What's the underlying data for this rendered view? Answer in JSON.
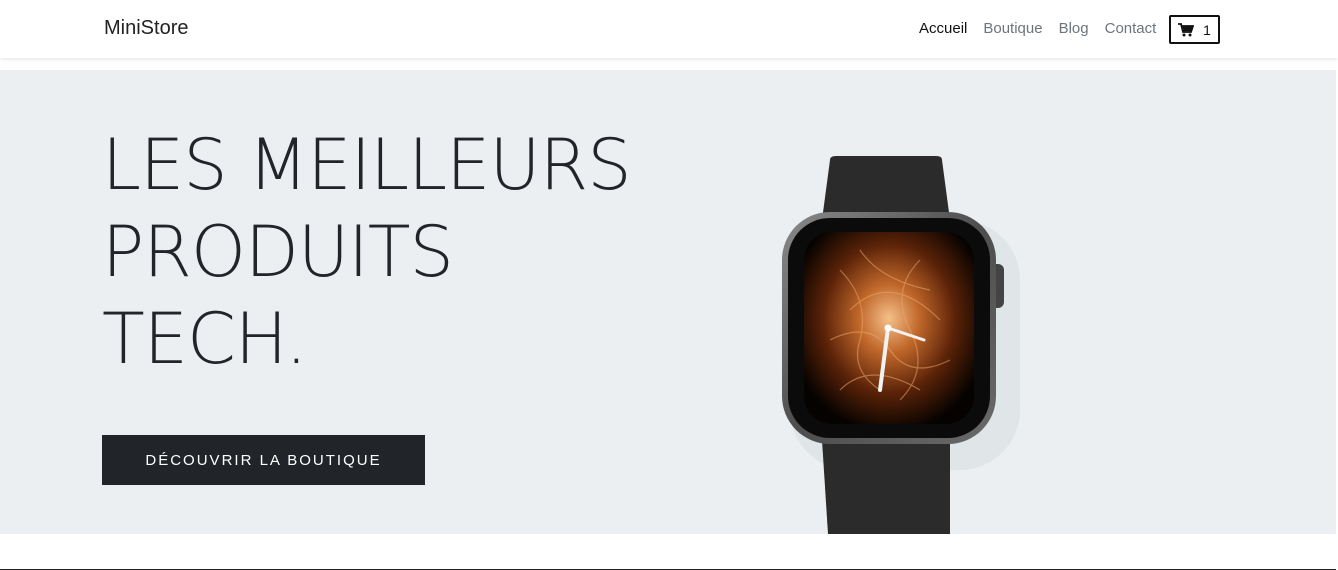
{
  "navbar": {
    "brand": "MiniStore",
    "links": [
      "Accueil",
      "Boutique",
      "Blog",
      "Contact"
    ],
    "cart_count": "1"
  },
  "hero": {
    "headline_lines": [
      "LES MEILLEURS",
      "PRODUITS",
      "TECH."
    ],
    "cta_label": "DÉCOUVRIR LA BOUTIQUE",
    "image": "smartwatch"
  },
  "icons": {
    "cart": "shopping-cart-icon"
  },
  "colors": {
    "hero_background": "#eceff2",
    "button_background": "#212529",
    "text": "#212529",
    "nav_inactive": "#6c757d"
  }
}
